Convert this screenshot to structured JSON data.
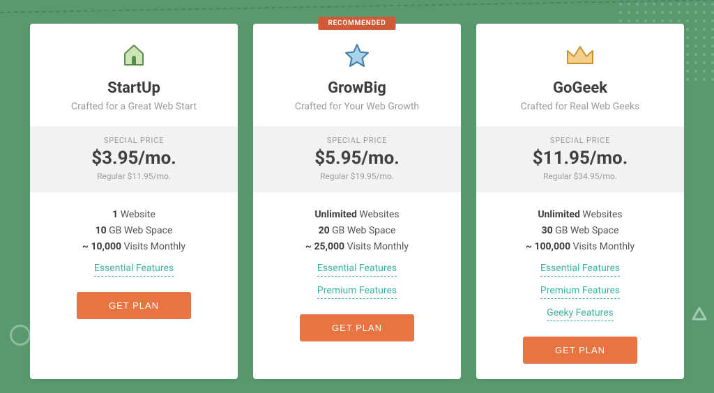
{
  "badge": "RECOMMENDED",
  "price_label": "SPECIAL PRICE",
  "cta": "GET PLAN",
  "plans": [
    {
      "name": "StartUp",
      "tagline": "Crafted for a Great Web Start",
      "price": "$3.95/mo.",
      "regular": "Regular $11.95/mo.",
      "f1b": "1",
      "f1r": " Website",
      "f2b": "10",
      "f2r": " GB Web Space",
      "f3b": "~ 10,000",
      "f3r": " Visits Monthly",
      "links": [
        "Essential Features"
      ]
    },
    {
      "name": "GrowBig",
      "tagline": "Crafted for Your Web Growth",
      "price": "$5.95/mo.",
      "regular": "Regular $19.95/mo.",
      "f1b": "Unlimited",
      "f1r": " Websites",
      "f2b": "20",
      "f2r": " GB Web Space",
      "f3b": "~ 25,000",
      "f3r": " Visits Monthly",
      "links": [
        "Essential Features",
        "Premium Features"
      ]
    },
    {
      "name": "GoGeek",
      "tagline": "Crafted for Real Web Geeks",
      "price": "$11.95/mo.",
      "regular": "Regular $34.95/mo.",
      "f1b": "Unlimited",
      "f1r": " Websites",
      "f2b": "30",
      "f2r": " GB Web Space",
      "f3b": "~ 100,000",
      "f3r": " Visits Monthly",
      "links": [
        "Essential Features",
        "Premium Features",
        "Geeky Features"
      ]
    }
  ]
}
